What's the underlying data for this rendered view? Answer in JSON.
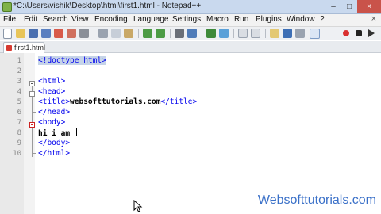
{
  "window": {
    "title": "*C:\\Users\\vishik\\Desktop\\html\\first1.html - Notepad++",
    "buttons": [
      "–",
      "□",
      "×"
    ]
  },
  "menu": {
    "items": [
      "File",
      "Edit",
      "Search",
      "View",
      "Encoding",
      "Language",
      "Settings",
      "Macro",
      "Run",
      "Plugins",
      "Window",
      "?"
    ],
    "close": "×"
  },
  "tabs": [
    {
      "label": "first1.html",
      "unsaved": true
    }
  ],
  "editor": {
    "line_numbers": [
      "1",
      "2",
      "3",
      "4",
      "5",
      "6",
      "7",
      "8",
      "9",
      "10"
    ],
    "lines": [
      {
        "segments": [
          {
            "text": "<!doctype html>",
            "kind": "doctype",
            "highlight": true
          }
        ]
      },
      {
        "segments": []
      },
      {
        "segments": [
          {
            "text": "<html>",
            "kind": "tag"
          }
        ]
      },
      {
        "segments": [
          {
            "text": "<head>",
            "kind": "tag"
          }
        ]
      },
      {
        "segments": [
          {
            "text": "<title>",
            "kind": "tag"
          },
          {
            "text": "websofttutorials.com",
            "kind": "txt"
          },
          {
            "text": "</title>",
            "kind": "tag"
          }
        ]
      },
      {
        "segments": [
          {
            "text": "</head>",
            "kind": "tag"
          }
        ]
      },
      {
        "segments": [
          {
            "text": "<body>",
            "kind": "tag"
          }
        ]
      },
      {
        "segments": [
          {
            "text": "hi i am ",
            "kind": "txt"
          }
        ]
      },
      {
        "segments": [
          {
            "text": "</body>",
            "kind": "tag"
          }
        ]
      },
      {
        "segments": [
          {
            "text": "</html>",
            "kind": "tag"
          }
        ]
      }
    ]
  },
  "toolbar_icons": [
    "new-file-icon",
    "open-icon",
    "save-icon",
    "save-all-icon",
    "close-icon",
    "close-all-icon",
    "print-icon",
    "cut-icon",
    "copy-icon",
    "paste-icon",
    "undo-icon",
    "redo-icon",
    "find-icon",
    "replace-icon",
    "zoom-in-icon",
    "zoom-out-icon",
    "sync-v-icon",
    "sync-h-icon",
    "word-wrap-icon",
    "all-chars-icon",
    "indent-guide-icon",
    "fold-icon",
    "record-macro-icon",
    "stop-macro-icon",
    "play-macro-icon",
    "play-multi-icon"
  ],
  "colors": {
    "tag": "#0000ee",
    "text": "#000000",
    "highlight": "#c6d4e8",
    "watermark": "#3a70c8"
  },
  "watermark": "Websofttutorials.com"
}
